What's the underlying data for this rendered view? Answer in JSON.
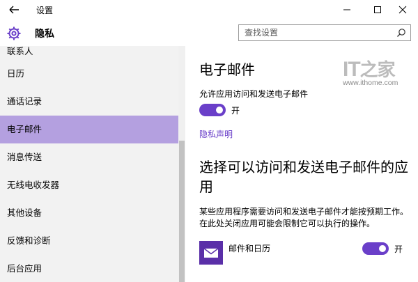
{
  "window": {
    "title": "设置"
  },
  "header": {
    "section": "隐私",
    "search_placeholder": "查找设置"
  },
  "sidebar": {
    "partial_item": "联系人",
    "items": [
      {
        "label": "日历"
      },
      {
        "label": "通话记录"
      },
      {
        "label": "电子邮件",
        "selected": true
      },
      {
        "label": "消息传送"
      },
      {
        "label": "无线电收发器"
      },
      {
        "label": "其他设备"
      },
      {
        "label": "反馈和诊断"
      },
      {
        "label": "后台应用"
      }
    ]
  },
  "content": {
    "title": "电子邮件",
    "allow_label": "允许应用访问和发送电子邮件",
    "allow_toggle": {
      "state": "on",
      "label": "开"
    },
    "privacy_link": "隐私声明",
    "choose_title": "选择可以访问和发送电子邮件的应用",
    "description": "某些应用程序需要访问和发送电子邮件才能按预期工作。在此处关闭应用可能会限制它可以执行的操作。",
    "apps": [
      {
        "name": "邮件和日历",
        "toggle": {
          "state": "on",
          "label": "开"
        },
        "icon": "mail-icon"
      }
    ]
  },
  "watermark": {
    "logo": "IT之家",
    "url": "www.ithome.com"
  },
  "colors": {
    "accent": "#6a3fc9",
    "selected_bg": "#b4a0e0",
    "sidebar_bg": "#f2f2f2",
    "app_icon_bg": "#5a2fa8"
  }
}
